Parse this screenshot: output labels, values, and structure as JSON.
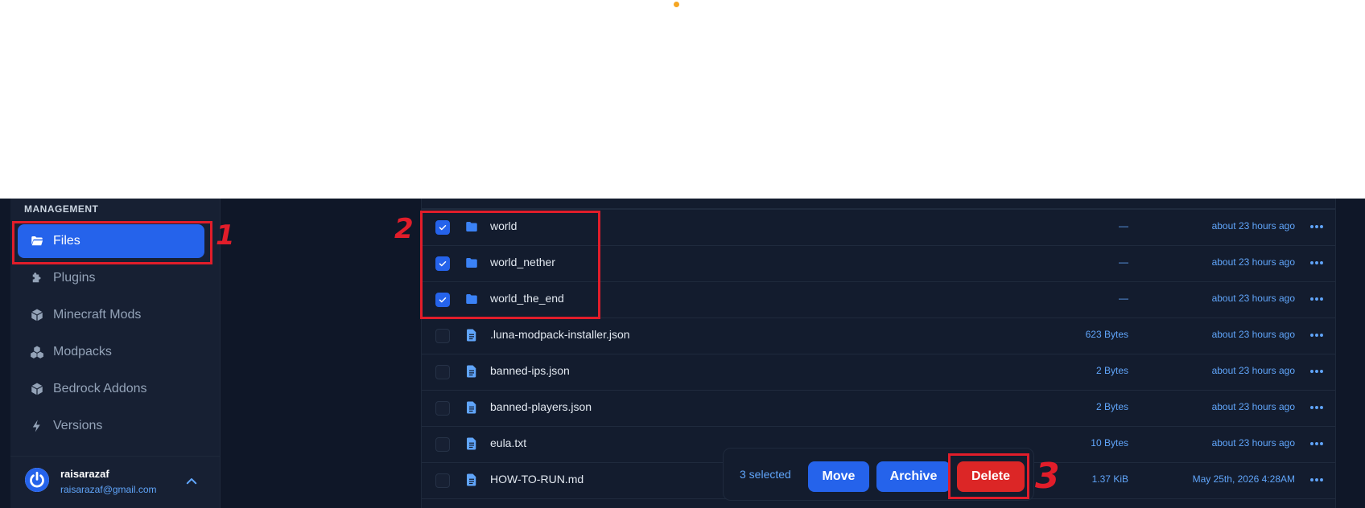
{
  "sidebar": {
    "section_label": "MANAGEMENT",
    "items": [
      {
        "label": "Files",
        "icon": "folder-open-icon",
        "active": true
      },
      {
        "label": "Plugins",
        "icon": "puzzle-icon",
        "active": false
      },
      {
        "label": "Minecraft Mods",
        "icon": "cube-icon",
        "active": false
      },
      {
        "label": "Modpacks",
        "icon": "cubes-icon",
        "active": false
      },
      {
        "label": "Bedrock Addons",
        "icon": "cube-icon",
        "active": false
      },
      {
        "label": "Versions",
        "icon": "bolt-icon",
        "active": false
      }
    ],
    "user": {
      "name": "raisarazaf",
      "email": "raisarazaf@gmail.com"
    }
  },
  "files": [
    {
      "name": "world",
      "type": "folder",
      "size": "—",
      "modified": "about 23 hours ago",
      "checked": true
    },
    {
      "name": "world_nether",
      "type": "folder",
      "size": "—",
      "modified": "about 23 hours ago",
      "checked": true
    },
    {
      "name": "world_the_end",
      "type": "folder",
      "size": "—",
      "modified": "about 23 hours ago",
      "checked": true
    },
    {
      "name": ".luna-modpack-installer.json",
      "type": "file",
      "size": "623 Bytes",
      "modified": "about 23 hours ago",
      "checked": false
    },
    {
      "name": "banned-ips.json",
      "type": "file",
      "size": "2 Bytes",
      "modified": "about 23 hours ago",
      "checked": false
    },
    {
      "name": "banned-players.json",
      "type": "file",
      "size": "2 Bytes",
      "modified": "about 23 hours ago",
      "checked": false
    },
    {
      "name": "eula.txt",
      "type": "file",
      "size": "10 Bytes",
      "modified": "about 23 hours ago",
      "checked": false
    },
    {
      "name": "HOW-TO-RUN.md",
      "type": "file",
      "size": "1.37 KiB",
      "modified": "May 25th, 2026 4:28AM",
      "checked": false
    }
  ],
  "action_bar": {
    "selected_text": "3 selected",
    "move_label": "Move",
    "archive_label": "Archive",
    "delete_label": "Delete"
  },
  "annotations": {
    "step1": "1",
    "step2": "2",
    "step3": "3"
  },
  "colors": {
    "accent": "#2563eb",
    "danger": "#dc2626",
    "highlight": "#e11d2a",
    "background": "#0f1728"
  }
}
